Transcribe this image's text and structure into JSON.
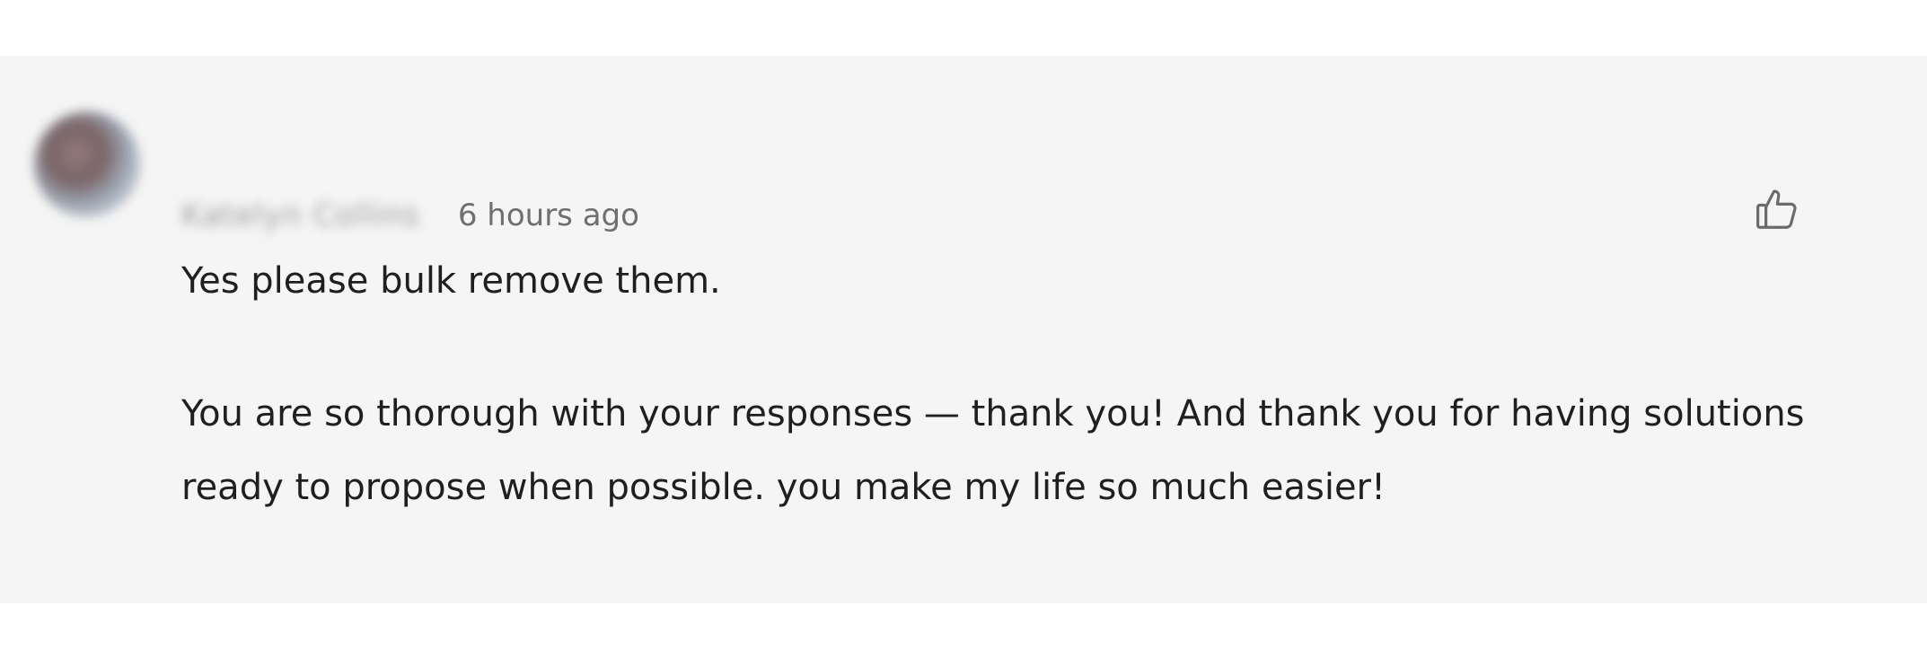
{
  "comment": {
    "author_name": "Katelyn Collins",
    "timestamp": "6 hours ago",
    "body_line_1": "Yes please bulk remove them.",
    "body_line_2": "You are so thorough with your responses — thank you! And thank you for having solutions",
    "body_line_3": "ready to propose when possible. you make my life so much easier!",
    "like_icon": "thumbs-up-icon"
  },
  "colors": {
    "card_background": "#f5f5f5",
    "page_background": "#ffffff",
    "body_text": "#1f1f1f",
    "meta_text": "#6f6f6f",
    "icon_stroke": "#6a6a6a"
  }
}
